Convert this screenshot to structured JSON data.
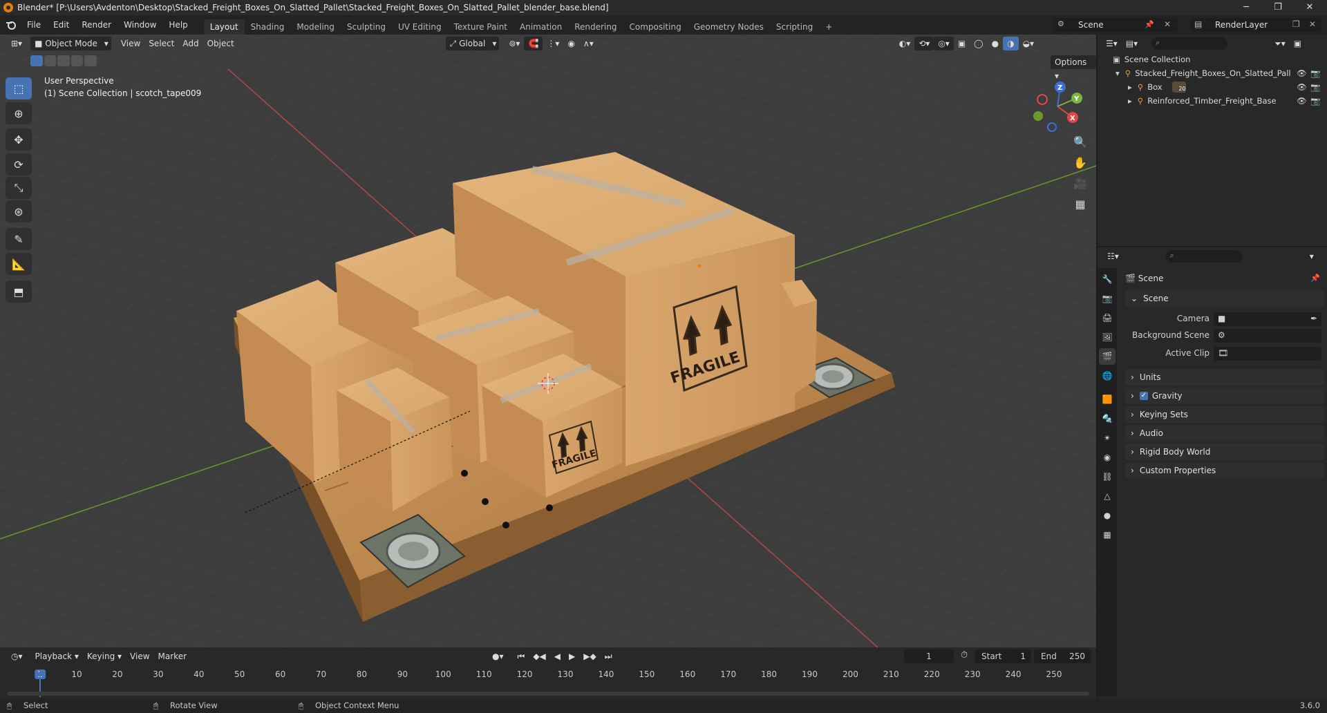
{
  "title_bar": {
    "title": "Blender* [P:\\Users\\Avdenton\\Desktop\\Stacked_Freight_Boxes_On_Slatted_Pallet\\Stacked_Freight_Boxes_On_Slatted_Pallet_blender_base.blend]",
    "min": "─",
    "max": "❐",
    "close": "✕"
  },
  "menu": {
    "items": [
      "File",
      "Edit",
      "Render",
      "Window",
      "Help"
    ],
    "workspaces": [
      "Layout",
      "Shading",
      "Modeling",
      "Sculpting",
      "UV Editing",
      "Texture Paint",
      "Animation",
      "Rendering",
      "Compositing",
      "Geometry Nodes",
      "Scripting"
    ],
    "add_workspace": "+",
    "scene": "Scene",
    "render_layer": "RenderLayer"
  },
  "viewport_header": {
    "mode": "Object Mode",
    "menus": [
      "View",
      "Select",
      "Add",
      "Object"
    ],
    "transform_orientation": "Global",
    "options": "Options"
  },
  "viewport": {
    "perspective": "User Perspective",
    "collection_info": "(1) Scene Collection | scotch_tape009",
    "label_fragile_big": "FRAGILE",
    "label_fragile_small": "FRAGILE",
    "gizmo": {
      "z": "Z",
      "y": "Y",
      "x": "X"
    }
  },
  "outliner": {
    "root": "Scene Collection",
    "items": [
      {
        "label": "Stacked_Freight_Boxes_On_Slatted_Pall"
      },
      {
        "label": "Box"
      },
      {
        "label": "Reinforced_Timber_Freight_Base"
      }
    ],
    "box_count": "20"
  },
  "properties": {
    "header_title": "Scene",
    "panel_scene": "Scene",
    "camera_label": "Camera",
    "background_scene_label": "Background Scene",
    "active_clip_label": "Active Clip",
    "sections": [
      "Units",
      "Gravity",
      "Keying Sets",
      "Audio",
      "Rigid Body World",
      "Custom Properties"
    ],
    "gravity_checked": true
  },
  "timeline": {
    "menus": [
      "Playback",
      "Keying",
      "View",
      "Marker"
    ],
    "current_frame": "1",
    "start_label": "Start",
    "start": "1",
    "end_label": "End",
    "end": "250",
    "ticks": [
      "1",
      "10",
      "20",
      "30",
      "40",
      "50",
      "60",
      "70",
      "80",
      "90",
      "100",
      "110",
      "120",
      "130",
      "140",
      "150",
      "160",
      "170",
      "180",
      "190",
      "200",
      "210",
      "220",
      "230",
      "240",
      "250"
    ]
  },
  "status_bar": {
    "select": "Select",
    "rotate": "Rotate View",
    "context": "Object Context Menu",
    "version": "3.6.0"
  },
  "colors": {
    "accent": "#4772b3",
    "viewport_bg": "#3d3d3d",
    "cardboard": "#d9a56b",
    "wood": "#c8955a",
    "axis_x": "#c04545",
    "axis_y": "#6a9a2a"
  }
}
